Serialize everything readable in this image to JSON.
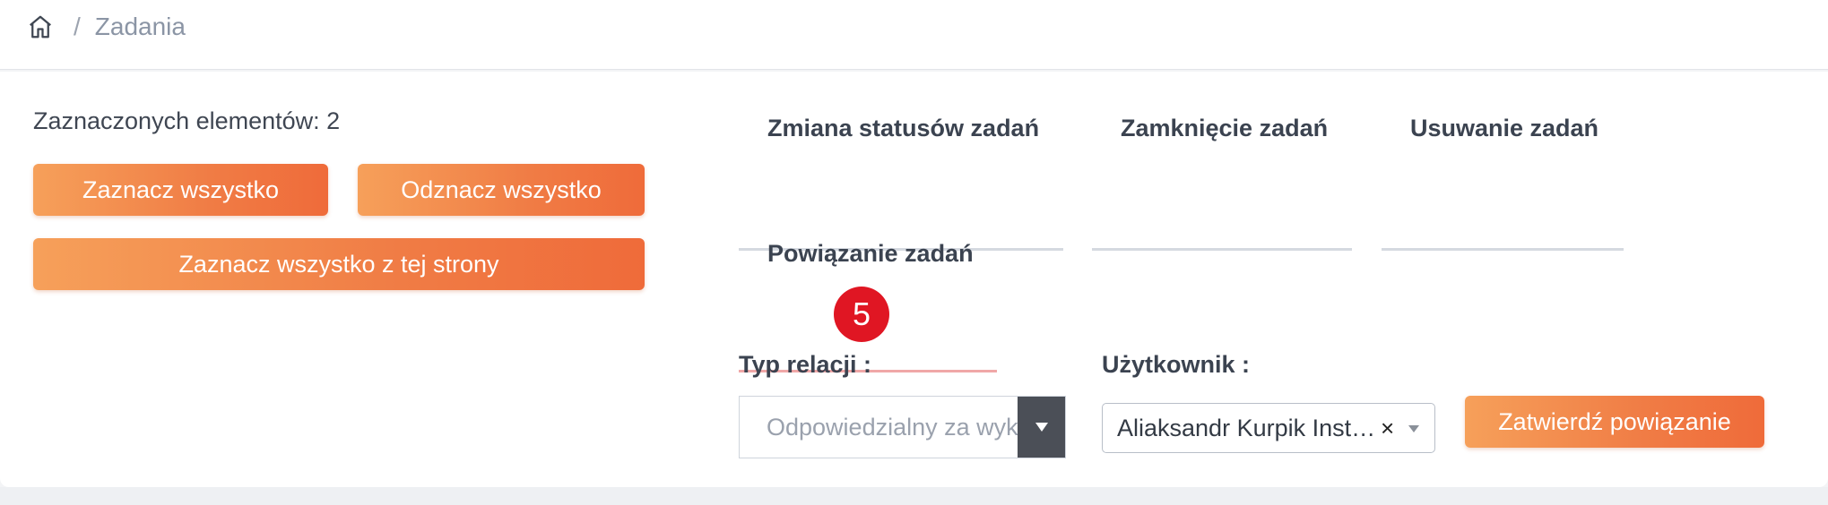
{
  "breadcrumb": {
    "home_icon": "home-icon",
    "separator": "/",
    "current": "Zadania"
  },
  "selection": {
    "count_label": "Zaznaczonych elementów: 2",
    "select_all_label": "Zaznacz wszystko",
    "deselect_all_label": "Odznacz wszystko",
    "select_page_label": "Zaznacz wszystko z tej strony"
  },
  "tabs": [
    {
      "label": "Zmiana statusów zadań"
    },
    {
      "label": "Zamknięcie zadań"
    },
    {
      "label": "Usuwanie zadań"
    },
    {
      "label": "Powiązanie zadań"
    }
  ],
  "badge": {
    "value": "5"
  },
  "form": {
    "relation_label": "Typ relacji :",
    "relation_value": "Odpowiedzialny za wykonanie",
    "user_label": "Użytkownik :",
    "user_value": "Aliaksandr Kurpik Instalator",
    "user_clear": "×",
    "confirm_label": "Zatwierdź powiązanie"
  },
  "colors": {
    "accent_orange": "#f07c45",
    "badge_red": "#e01623",
    "active_tab_underline": "#f0a7a7"
  }
}
